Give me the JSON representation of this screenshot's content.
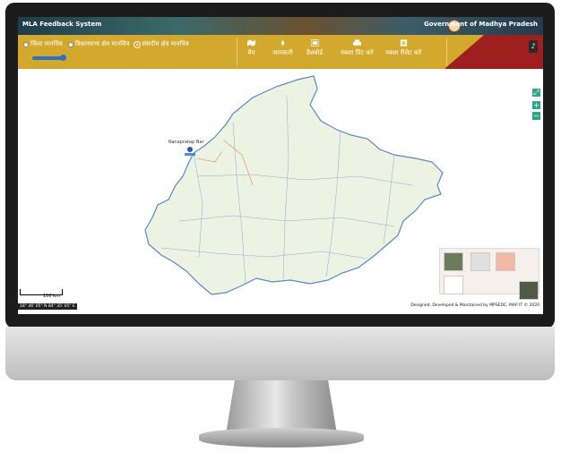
{
  "header": {
    "app_title": "MLA Feedback System",
    "government": "Government of Madhya Pradesh"
  },
  "layer_radios": [
    {
      "label": "जिला मानचित्र",
      "selected": false
    },
    {
      "label": "विधानसभा क्षेत्र मानचित्र",
      "selected": false
    },
    {
      "label": "संसदीय क्षेत्र मानचित्र",
      "selected": true
    }
  ],
  "toolbar": {
    "map": "मैप",
    "info": "जानकारी",
    "dashboard": "डैशबोर्ड",
    "print": "नक्शा प्रिंट करें",
    "reset": "नक्शा रीसेट करें"
  },
  "map": {
    "scale_label": "100 km",
    "coords": "18° 46' 05\" N 84° 35' 05\" E",
    "credit": "Designed, Developed & Maintained by MPSEDC, MAP IT © 2020",
    "place_label": "Ranapratap Nar",
    "fill_color": "#edf3e3",
    "boundary_color": "#5a88c7"
  }
}
